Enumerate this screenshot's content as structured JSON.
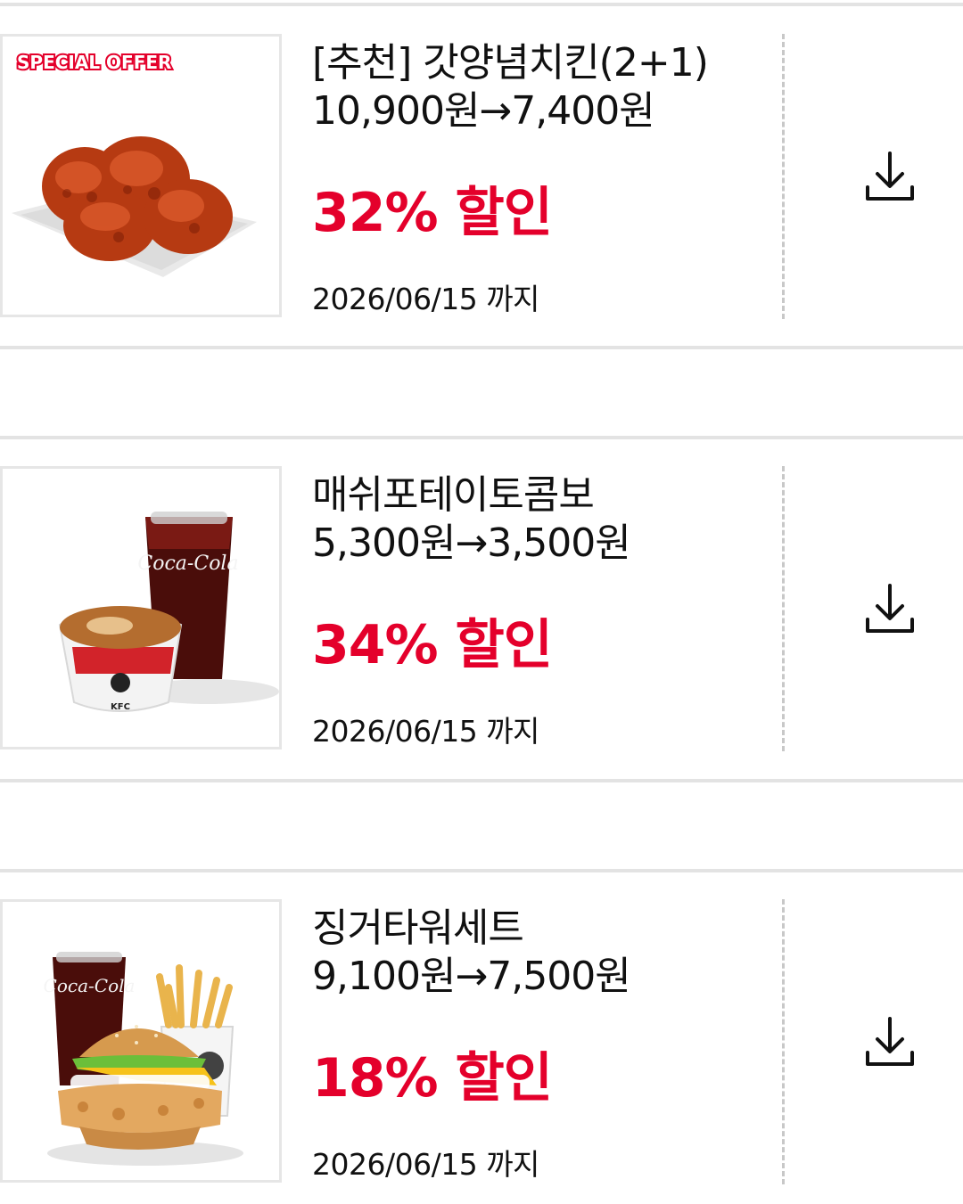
{
  "colors": {
    "accent": "#e4002b",
    "separator": "#e3e3e3"
  },
  "coupons": [
    {
      "badge": "SPECIAL OFFER",
      "title": "[추천] 갓양념치킨(2+1)",
      "price": "10,900원→7,400원",
      "discount": "32% 할인",
      "expiry": "2026/06/15 까지",
      "image_icon": "spicy-fried-chicken-image",
      "action_icon": "download-icon"
    },
    {
      "title": "매쉬포테이토콤보",
      "price": "5,300원→3,500원",
      "discount": "34% 할인",
      "expiry": "2026/06/15 까지",
      "image_icon": "mashed-potato-and-cola-image",
      "image_text": {
        "cup_logo": "Coca-Cola",
        "bowl_logo": "KFC"
      },
      "action_icon": "download-icon"
    },
    {
      "title": "징거타워세트",
      "price": "9,100원→7,500원",
      "discount": "18% 할인",
      "expiry": "2026/06/15 까지",
      "image_icon": "burger-fries-cola-set-image",
      "image_text": {
        "cup_logo": "Coca-Cola"
      },
      "action_icon": "download-icon"
    }
  ]
}
